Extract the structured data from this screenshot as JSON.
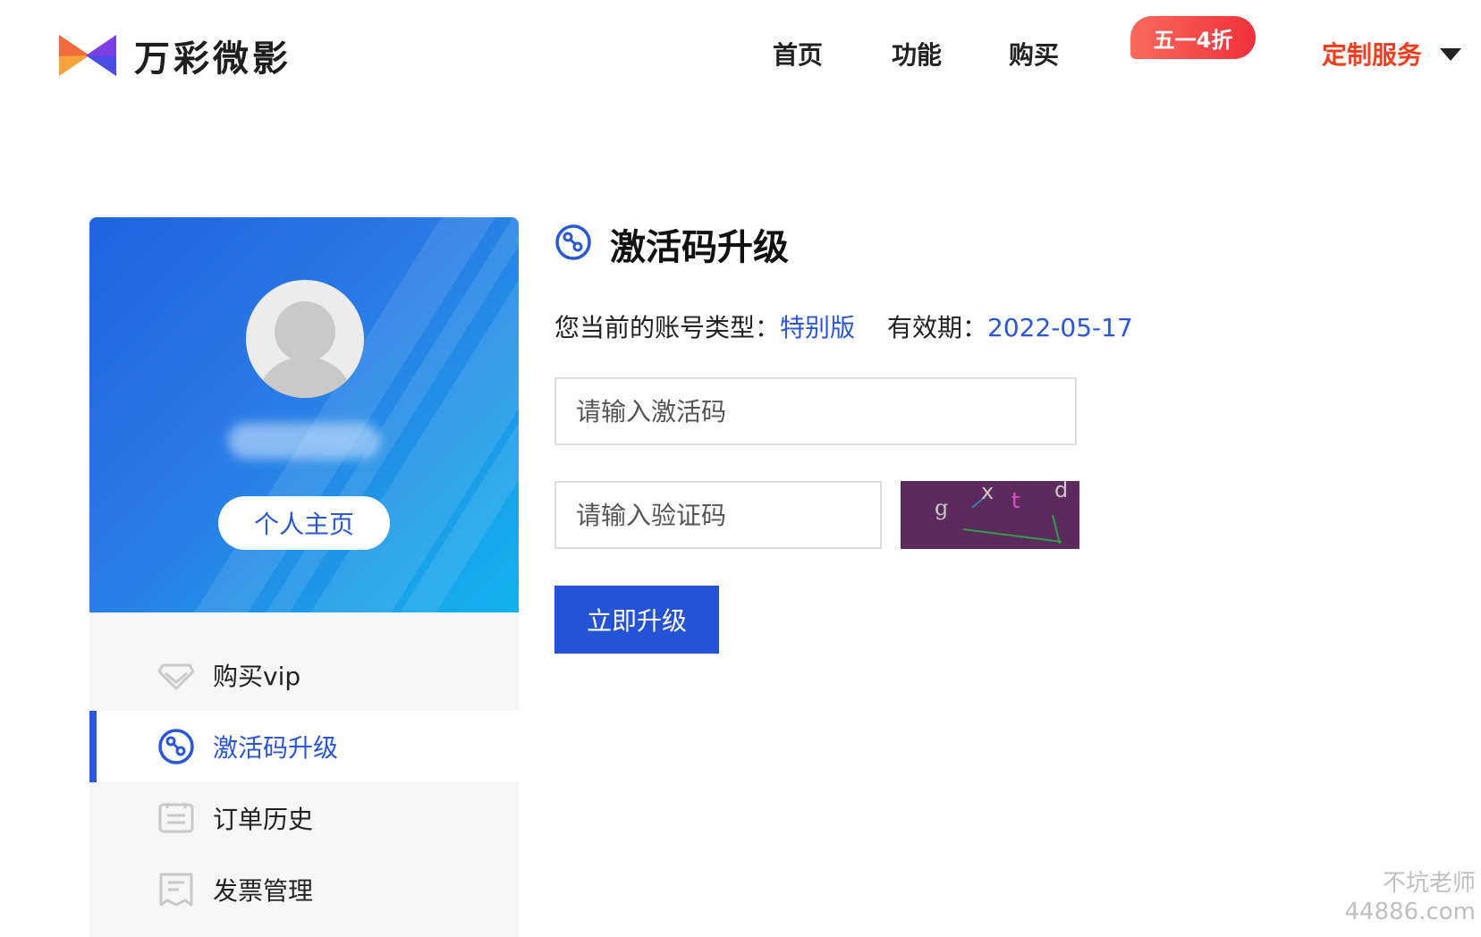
{
  "brand": {
    "name": "万彩微影"
  },
  "nav": {
    "home": "首页",
    "features": "功能",
    "buy": "购买",
    "promo_badge": "五一4折",
    "custom_service": "定制服务"
  },
  "sidebar": {
    "home_button": "个人主页",
    "items": [
      {
        "label": "购买vip",
        "icon": "diamond-icon"
      },
      {
        "label": "激活码升级",
        "icon": "key-badge-icon",
        "active": true
      },
      {
        "label": "订单历史",
        "icon": "list-icon"
      },
      {
        "label": "发票管理",
        "icon": "invoice-icon"
      }
    ]
  },
  "main": {
    "title": "激活码升级",
    "account_type_label": "您当前的账号类型：",
    "account_type_value": "特别版",
    "validity_label": "有效期：",
    "validity_value": "2022-05-17",
    "activation_input": {
      "placeholder": "请输入激活码"
    },
    "captcha_input": {
      "placeholder": "请输入验证码"
    },
    "captcha_chars": [
      "g",
      "x",
      "t",
      "d"
    ],
    "upgrade_button": "立即升级"
  },
  "watermark": {
    "line1": "不坑老师",
    "line2": "44886.com"
  },
  "colors": {
    "accent": "#2a56d8",
    "nav_highlight": "#f23d1f",
    "promo_badge": "#f0303b",
    "sidebar_bg": "#f6f6f6",
    "captcha_bg": "#5c2a5c"
  }
}
